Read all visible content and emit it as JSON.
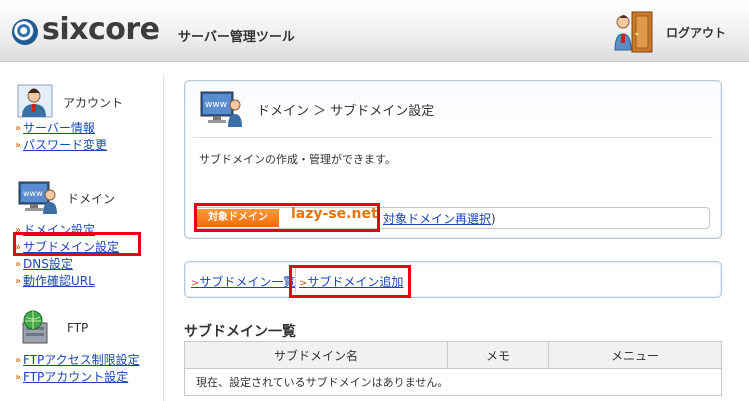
{
  "header": {
    "logo_text": "sixcore",
    "logo_subtitle": "サーバー管理ツール",
    "logout_label": "ログアウト"
  },
  "sidebar": {
    "groups": [
      {
        "label": "アカウント",
        "icon": "user-icon",
        "links": [
          "サーバー情報",
          "パスワード変更"
        ]
      },
      {
        "label": "ドメイン",
        "icon": "www-monitor-icon",
        "links": [
          "ドメイン設定",
          "サブドメイン設定",
          "DNS設定",
          "動作確認URL"
        ]
      },
      {
        "label": "FTP",
        "icon": "ftp-globe-icon",
        "links": [
          "FTPアクセス制限設定",
          "FTPアカウント設定"
        ]
      }
    ]
  },
  "main": {
    "breadcrumb": "ドメイン ＞ サブドメイン設定",
    "description": "サブドメインの作成・管理ができます。",
    "domain_badge": "対象ドメイン",
    "domain_name": "lazy-se.net",
    "reselect_link": "対象ドメイン再選択",
    "reselect_suffix": ")",
    "tabs": [
      "サブドメイン一覧",
      "サブドメイン追加"
    ],
    "section_title": "サブドメイン一覧",
    "table": {
      "headers": [
        "サブドメイン名",
        "メモ",
        "メニュー"
      ],
      "empty_message": "現在、設定されているサブドメインはありません。"
    }
  },
  "colors": {
    "link": "#1a47b3",
    "highlight": "#e60012",
    "domain_accent": "#e6720b"
  }
}
